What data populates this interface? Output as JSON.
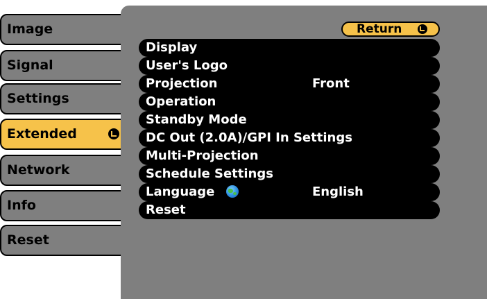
{
  "sidebar": {
    "items": [
      {
        "label": "Image"
      },
      {
        "label": "Signal"
      },
      {
        "label": "Settings"
      },
      {
        "label": "Extended",
        "selected": true
      },
      {
        "label": "Network"
      },
      {
        "label": "Info"
      },
      {
        "label": "Reset"
      }
    ]
  },
  "panel": {
    "return_label": "Return",
    "menu": [
      {
        "label": "Display",
        "value": ""
      },
      {
        "label": "User's Logo",
        "value": ""
      },
      {
        "label": "Projection",
        "value": "Front"
      },
      {
        "label": "Operation",
        "value": ""
      },
      {
        "label": "Standby Mode",
        "value": ""
      },
      {
        "label": "DC Out (2.0A)/GPI In Settings",
        "value": ""
      },
      {
        "label": "Multi-Projection",
        "value": ""
      },
      {
        "label": "Schedule Settings",
        "value": ""
      },
      {
        "label": "Language",
        "value": "English",
        "icon": "globe-icon"
      },
      {
        "label": "Reset",
        "value": ""
      }
    ]
  },
  "colors": {
    "panel": "#7f7f7f",
    "selected": "#f6c24a",
    "row": "#000000",
    "text_light": "#ffffff"
  }
}
